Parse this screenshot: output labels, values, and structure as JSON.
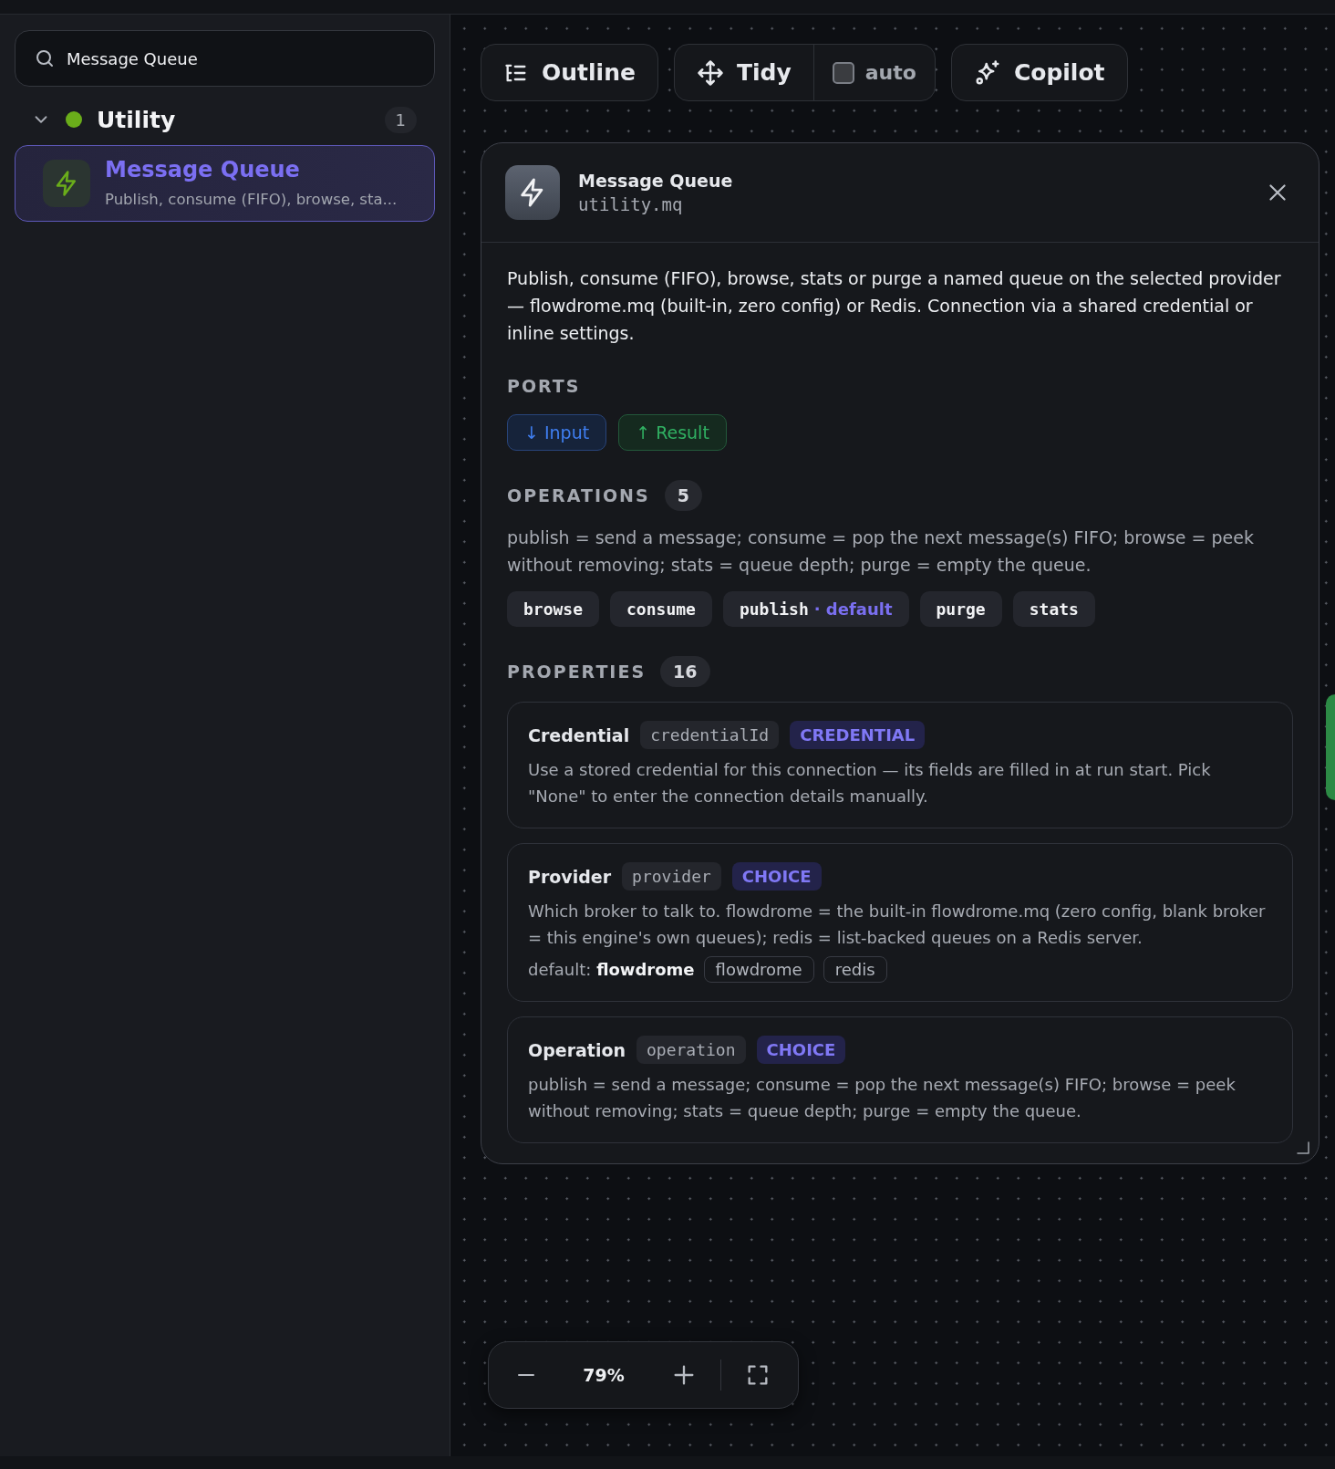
{
  "search": {
    "value": "Message Queue"
  },
  "sidebar": {
    "groups": [
      {
        "label": "Utility",
        "color": "#6aad1a",
        "count": "1",
        "expanded": true,
        "items": [
          {
            "title": "Message Queue",
            "subtitle": "Publish, consume (FIFO), browse, sta...",
            "selected": true
          }
        ]
      }
    ]
  },
  "toolbar": {
    "outline": "Outline",
    "tidy": "Tidy",
    "auto": {
      "label": "auto",
      "checked": false
    },
    "copilot": "Copilot"
  },
  "panel": {
    "title": "Message Queue",
    "id": "utility.mq",
    "description": "Publish, consume (FIFO), browse, stats or purge a named queue on the selected provider — flowdrome.mq (built-in, zero config) or Redis. Connection via a shared credential or inline settings.",
    "ports_heading": "PORTS",
    "ports": [
      {
        "label": "↓ Input",
        "kind": "input"
      },
      {
        "label": "↑ Result",
        "kind": "output"
      }
    ],
    "operations": {
      "heading": "OPERATIONS",
      "count": "5",
      "description": "publish = send a message; consume = pop the next message(s) FIFO; browse = peek without removing; stats = queue depth; purge = empty the queue.",
      "items": [
        {
          "name": "browse",
          "default": false
        },
        {
          "name": "consume",
          "default": false
        },
        {
          "name": "publish",
          "default": true
        },
        {
          "name": "purge",
          "default": false
        },
        {
          "name": "stats",
          "default": false
        }
      ],
      "default_tag": "· default"
    },
    "properties": {
      "heading": "PROPERTIES",
      "count": "16",
      "items": [
        {
          "label": "Credential",
          "key": "credentialId",
          "type": "CREDENTIAL",
          "description": "Use a stored credential for this connection — its fields are filled in at run start. Pick \"None\" to enter the connection details manually."
        },
        {
          "label": "Provider",
          "key": "provider",
          "type": "CHOICE",
          "description": "Which broker to talk to. flowdrome = the built-in flowdrome.mq (zero config, blank broker = this engine's own queues); redis = list-backed queues on a Redis server.",
          "default": "default: **flowdrome**",
          "options": [
            "flowdrome",
            "redis"
          ]
        },
        {
          "label": "Operation",
          "key": "operation",
          "type": "CHOICE",
          "description": "publish = send a message; consume = pop the next message(s) FIFO; browse = peek without removing; stats = queue depth; purge = empty the queue."
        }
      ]
    }
  },
  "zoom": {
    "value": "79%"
  }
}
